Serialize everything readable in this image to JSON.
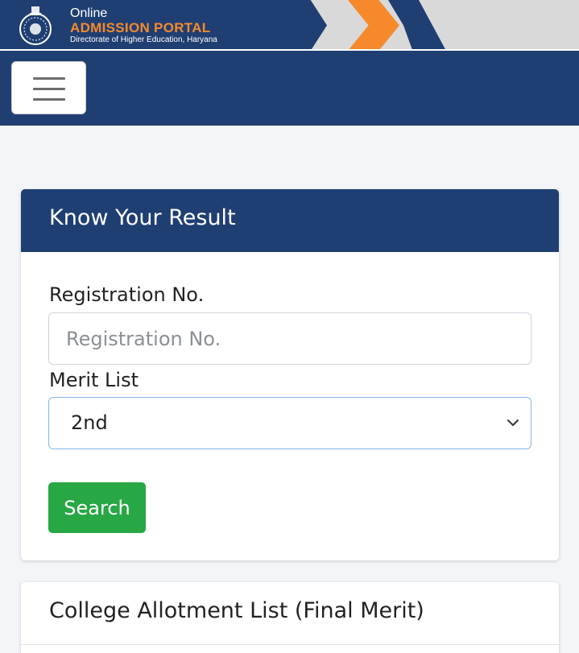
{
  "header": {
    "brand_online": "Online",
    "brand_title": "ADMISSION PORTAL",
    "brand_subtitle": "Directorate of Higher Education, Haryana",
    "logo_icon": "haryana-emblem-icon",
    "menu_icon": "hamburger-menu-icon"
  },
  "colors": {
    "primary": "#1f3f73",
    "accent": "#f5892c",
    "success": "#28a745",
    "page_bg": "#f3f5f9"
  },
  "result_card": {
    "title": "Know Your Result",
    "registration_label": "Registration No.",
    "registration_value": "",
    "registration_placeholder": "Registration No.",
    "merit_label": "Merit List",
    "merit_selected": "2nd",
    "search_label": "Search"
  },
  "allotment_card": {
    "title": "College Allotment List (Final Merit)"
  }
}
